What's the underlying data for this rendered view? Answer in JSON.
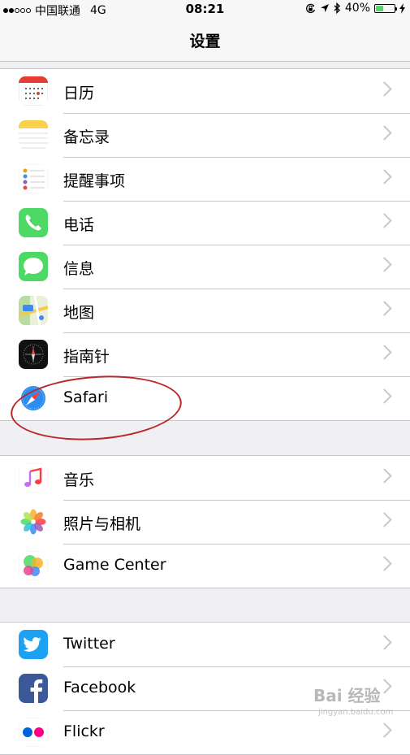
{
  "status_bar": {
    "signal_dots": [
      true,
      true,
      false,
      false,
      false
    ],
    "carrier": "中国联通",
    "network": "4G",
    "time": "08:21",
    "battery_percent": "40%",
    "battery_level": 0.4
  },
  "nav": {
    "title": "设置"
  },
  "groups": [
    {
      "id": "apps",
      "items": [
        {
          "label": "日历",
          "icon": "calendar-icon"
        },
        {
          "label": "备忘录",
          "icon": "notes-icon"
        },
        {
          "label": "提醒事项",
          "icon": "reminders-icon"
        },
        {
          "label": "电话",
          "icon": "phone-icon"
        },
        {
          "label": "信息",
          "icon": "messages-icon"
        },
        {
          "label": "地图",
          "icon": "maps-icon"
        },
        {
          "label": "指南针",
          "icon": "compass-icon"
        },
        {
          "label": "Safari",
          "icon": "safari-icon"
        }
      ]
    },
    {
      "id": "media",
      "items": [
        {
          "label": "音乐",
          "icon": "music-icon"
        },
        {
          "label": "照片与相机",
          "icon": "photos-icon"
        },
        {
          "label": "Game Center",
          "icon": "game-center-icon"
        }
      ]
    },
    {
      "id": "social",
      "items": [
        {
          "label": "Twitter",
          "icon": "twitter-icon"
        },
        {
          "label": "Facebook",
          "icon": "facebook-icon"
        },
        {
          "label": "Flickr",
          "icon": "flickr-icon"
        }
      ]
    }
  ],
  "colors": {
    "annotation": "#b8282a",
    "battery": "#4cd964",
    "twitter": "#1da1f2",
    "facebook": "#3b5998"
  },
  "watermark": {
    "text": "Bai 经验",
    "sub": "jingyan.baidu.com"
  }
}
